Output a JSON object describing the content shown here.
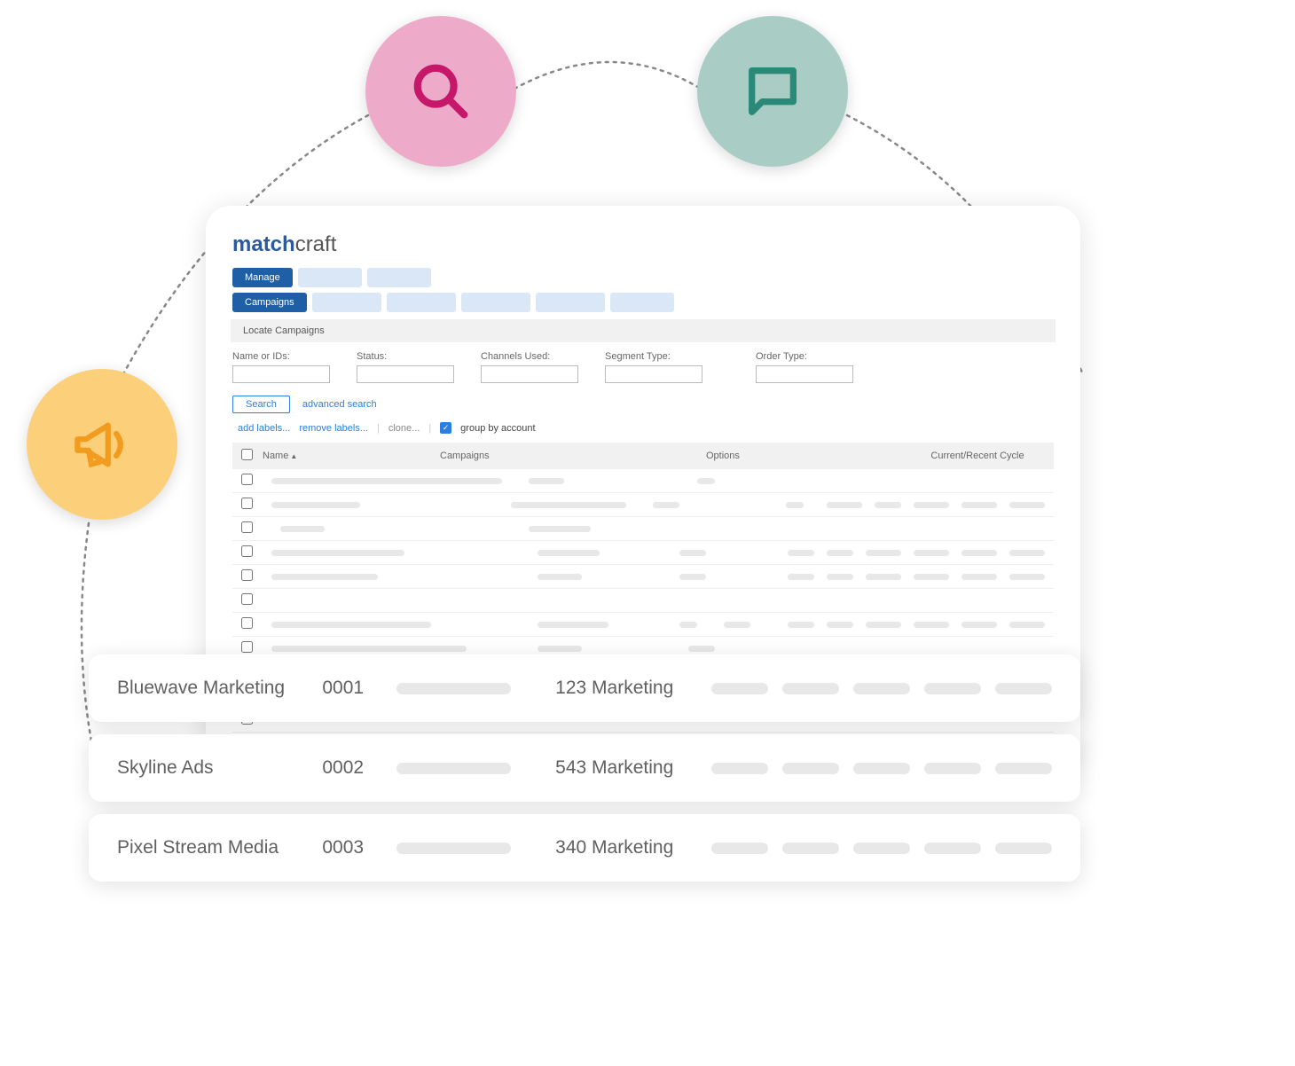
{
  "logo": {
    "part1": "match",
    "part2": "craft"
  },
  "tabs_primary": {
    "active": "Manage"
  },
  "tabs_secondary": {
    "active": "Campaigns"
  },
  "section_title": "Locate Campaigns",
  "filters": {
    "name": "Name or IDs:",
    "status": "Status:",
    "channels": "Channels Used:",
    "segment": "Segment Type:",
    "order": "Order Type:"
  },
  "buttons": {
    "search": "Search",
    "advanced": "advanced search",
    "add_labels": "add labels...",
    "remove_labels": "remove labels...",
    "clone": "clone...",
    "group_by": "group by account"
  },
  "table": {
    "headers": {
      "name": "Name",
      "campaigns": "Campaigns",
      "options": "Options",
      "cycle": "Current/Recent Cycle"
    }
  },
  "cards": [
    {
      "name": "Bluewave Marketing",
      "id": "0001",
      "label": "123 Marketing"
    },
    {
      "name": "Skyline Ads",
      "id": "0002",
      "label": "543 Marketing"
    },
    {
      "name": "Pixel Stream Media",
      "id": "0003",
      "label": "340 Marketing"
    }
  ]
}
